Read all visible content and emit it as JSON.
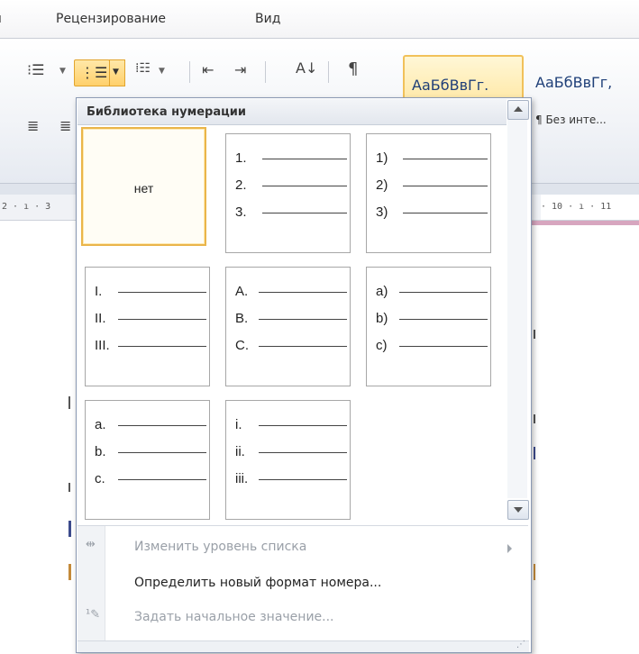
{
  "ribbon": {
    "tabs": [
      {
        "label": "Рецензирование"
      },
      {
        "label": "Вид"
      }
    ],
    "icons": [
      "bullets-icon",
      "numbering-icon",
      "multilevel-list-icon",
      "decrease-indent-icon",
      "increase-indent-icon",
      "sort-icon",
      "show-marks-icon",
      "align-left-icon"
    ],
    "styles": {
      "sample1": "АаБбВвГг.",
      "sample2": "АаБбВвГг,",
      "name2": "¶ Без инте..."
    },
    "ruler_left": "2 · ı · 3",
    "ruler_right": "· 10 · ı · 11"
  },
  "numbering_menu": {
    "header": "Библиотека нумерации",
    "none_label": "нет",
    "tiles": [
      [
        "1.",
        "2.",
        "3."
      ],
      [
        "1)",
        "2)",
        "3)"
      ],
      [
        "I.",
        "II.",
        "III."
      ],
      [
        "A.",
        "B.",
        "C."
      ],
      [
        "a)",
        "b)",
        "c)"
      ],
      [
        "a.",
        "b.",
        "c."
      ],
      [
        "i.",
        "ii.",
        "iii."
      ]
    ],
    "items": {
      "change_level": "Изменить уровень списка",
      "define_format": "Определить новый формат номера...",
      "set_value": "Задать начальное значение..."
    }
  },
  "colors": {
    "selection_border": "#eab54a",
    "accent_pink": "#d7a6bf",
    "menu_border": "#8a99b3"
  }
}
